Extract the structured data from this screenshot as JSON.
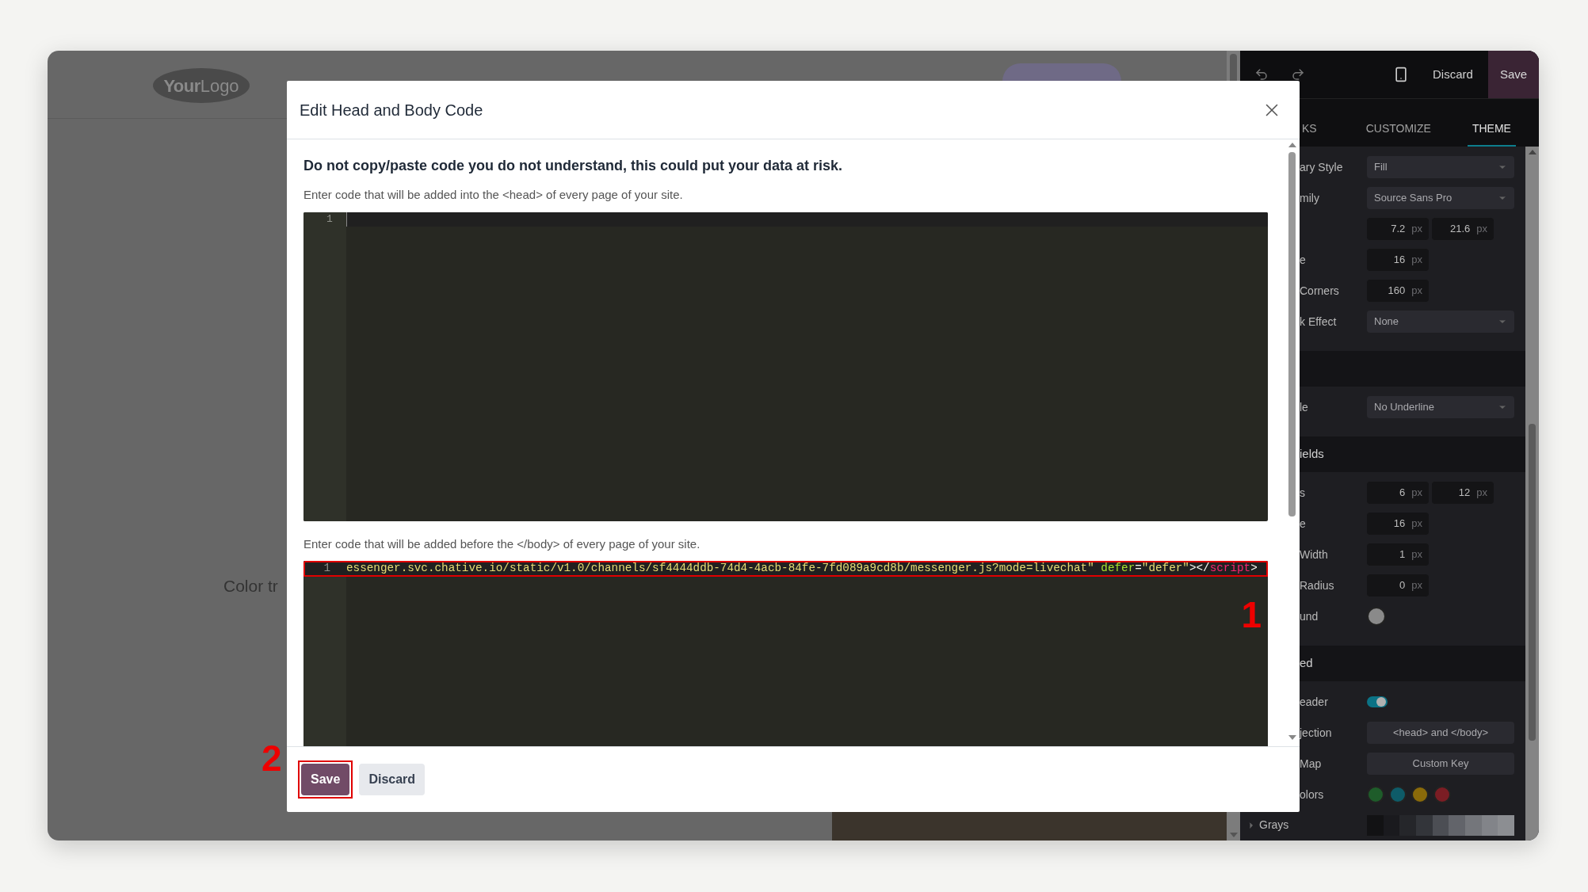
{
  "website": {
    "logo": {
      "bold": "Your",
      "light": "Logo"
    },
    "body_text": "Color tr"
  },
  "editor_panel": {
    "toolbar": {
      "discard": "Discard",
      "save": "Save"
    },
    "tabs": [
      {
        "label": "KS",
        "selected": false
      },
      {
        "label": "CUSTOMIZE",
        "selected": false
      },
      {
        "label": "THEME",
        "selected": true
      }
    ],
    "rows": [
      {
        "kind": "select",
        "label": "ary Style",
        "value": "Fill"
      },
      {
        "kind": "select",
        "label": "mily",
        "value": "Source Sans Pro"
      },
      {
        "kind": "numbers",
        "label": "",
        "values": [
          {
            "value": "7.2",
            "unit": "px"
          },
          {
            "value": "21.6",
            "unit": "px"
          }
        ]
      },
      {
        "kind": "numbers",
        "label": "e",
        "values": [
          {
            "value": "16",
            "unit": "px"
          }
        ]
      },
      {
        "kind": "numbers",
        "label": "Corners",
        "values": [
          {
            "value": "160",
            "unit": "px"
          }
        ]
      },
      {
        "kind": "select",
        "label": "k Effect",
        "value": "None"
      },
      {
        "kind": "section",
        "label": ""
      },
      {
        "kind": "select",
        "label": "le",
        "value": "No Underline"
      },
      {
        "kind": "section",
        "label": "ields"
      },
      {
        "kind": "numbers",
        "label": "s",
        "values": [
          {
            "value": "6",
            "unit": "px"
          },
          {
            "value": "12",
            "unit": "px"
          }
        ]
      },
      {
        "kind": "numbers",
        "label": "e",
        "values": [
          {
            "value": "16",
            "unit": "px"
          }
        ]
      },
      {
        "kind": "numbers",
        "label": "Width",
        "values": [
          {
            "value": "1",
            "unit": "px"
          }
        ]
      },
      {
        "kind": "numbers",
        "label": "Radius",
        "values": [
          {
            "value": "0",
            "unit": "px"
          }
        ]
      },
      {
        "kind": "swatch",
        "label": "und"
      },
      {
        "kind": "section",
        "label": "ed"
      },
      {
        "kind": "toggle",
        "label": "eader",
        "on": true
      },
      {
        "kind": "button",
        "label": "jection",
        "value": "<head> and </body>"
      },
      {
        "kind": "button",
        "label": "Map",
        "value": "Custom Key"
      },
      {
        "kind": "colors",
        "label": "olors",
        "colors": [
          {
            "color": "#1e5c2a"
          },
          {
            "color": "#0e5b68"
          },
          {
            "color": "#8a6a0a"
          },
          {
            "color": "#7b1d24"
          }
        ]
      },
      {
        "kind": "grays",
        "label": "Grays",
        "expanded": false
      }
    ]
  },
  "dialog": {
    "title": "Edit Head and Body Code",
    "warning": "Do not copy/paste code you do not understand, this could put your data at risk.",
    "head_label": "Enter code that will be added into the <head> of every page of your site.",
    "head_editor": {
      "line_numbers": [
        "1"
      ]
    },
    "body_label": "Enter code that will be added before the </body> of every page of your site.",
    "body_editor": {
      "line_numbers": [
        "1"
      ],
      "highlighted": true,
      "tokens": [
        {
          "kind": "string",
          "text": "essenger.svc.chative.io/static/v1.0/channels/sf4444ddb-74d4-4acb-84fe-7fd089a9cd8b/messenger.js?mode=livechat\""
        },
        {
          "kind": "attr",
          "text": " defer"
        },
        {
          "kind": "plain",
          "text": "="
        },
        {
          "kind": "string",
          "text": "\"defer\""
        },
        {
          "kind": "plain",
          "text": "></"
        },
        {
          "kind": "tag",
          "text": "script"
        },
        {
          "kind": "plain",
          "text": ">"
        }
      ]
    },
    "buttons": [
      {
        "label": "Save",
        "primary": true,
        "highlighted": true
      },
      {
        "label": "Discard",
        "primary": false,
        "highlighted": false
      }
    ]
  },
  "annotations": [
    {
      "text": "1"
    },
    {
      "text": "2"
    }
  ]
}
